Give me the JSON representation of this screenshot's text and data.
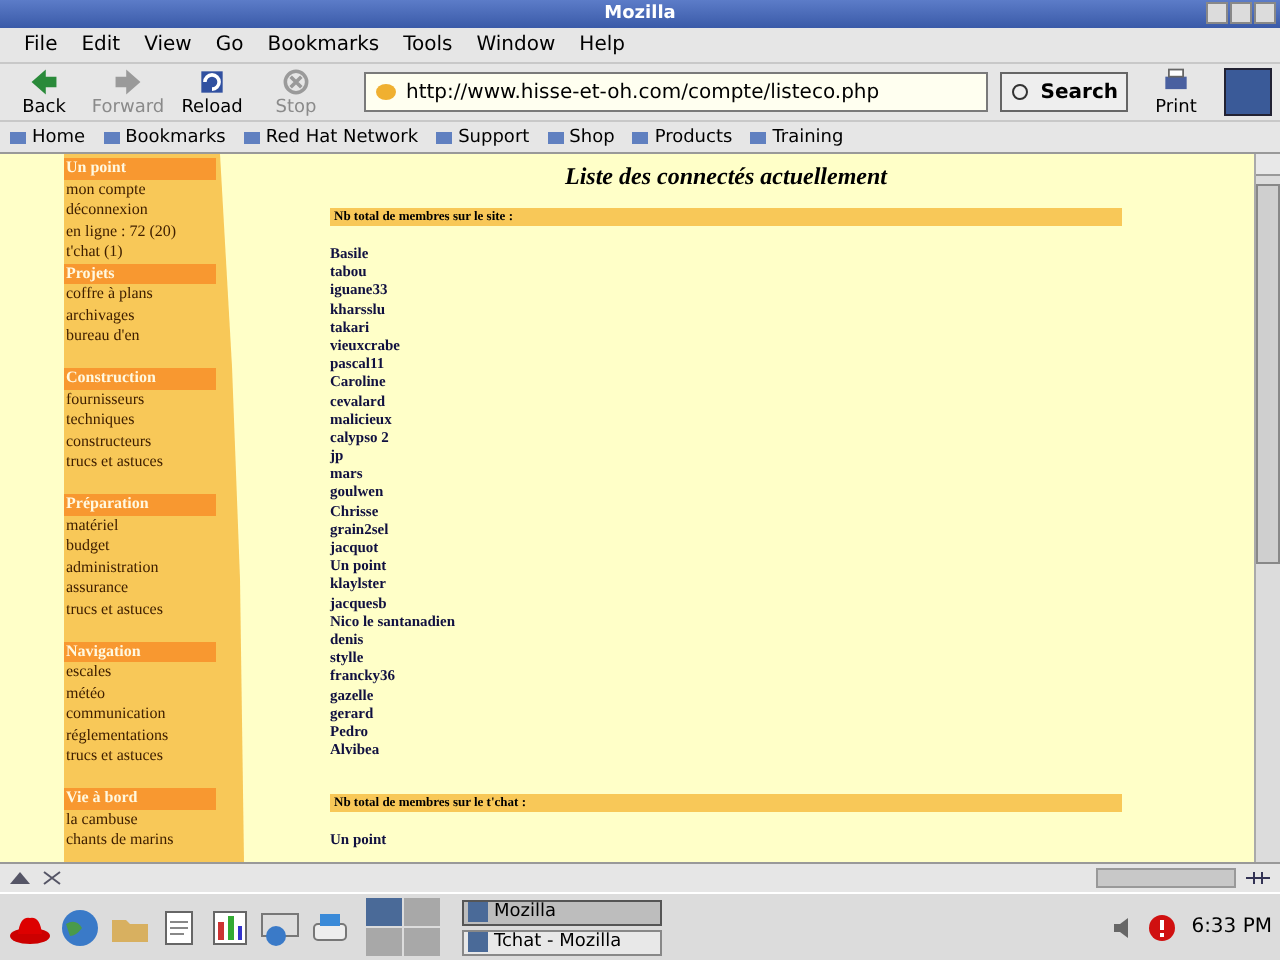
{
  "window": {
    "title": "Mozilla"
  },
  "menu": [
    "File",
    "Edit",
    "View",
    "Go",
    "Bookmarks",
    "Tools",
    "Window",
    "Help"
  ],
  "nav_buttons": [
    {
      "label": "Back",
      "disabled": false,
      "kind": "back"
    },
    {
      "label": "Forward",
      "disabled": true,
      "kind": "forward"
    },
    {
      "label": "Reload",
      "disabled": false,
      "kind": "reload"
    },
    {
      "label": "Stop",
      "disabled": true,
      "kind": "stop"
    }
  ],
  "address": {
    "value": "http://www.hisse-et-oh.com/compte/listeco.php"
  },
  "search_button": "Search",
  "print_button": "Print",
  "personal_toolbar": [
    "Home",
    "Bookmarks",
    "Red Hat Network",
    "Support",
    "Shop",
    "Products",
    "Training"
  ],
  "sidebar": [
    {
      "title": "Un point",
      "items": [
        "mon compte",
        "déconnexion",
        "en ligne : 72 (20)",
        "t'chat (1)"
      ]
    },
    {
      "title": "Projets",
      "items": [
        "coffre à plans",
        "archivages",
        "bureau d'en"
      ]
    },
    {
      "title": "Construction",
      "items": [
        "fournisseurs",
        "techniques",
        "constructeurs",
        "trucs et astuces"
      ]
    },
    {
      "title": "Préparation",
      "items": [
        "matériel",
        "budget",
        "administration",
        "assurance",
        "trucs et astuces"
      ]
    },
    {
      "title": "Navigation",
      "items": [
        "escales",
        "météo",
        "communication",
        "réglementations",
        "trucs et astuces"
      ]
    },
    {
      "title": "Vie à bord",
      "items": [
        "la cambuse",
        "chants de marins"
      ]
    }
  ],
  "page": {
    "title": "Liste des connectés actuellement",
    "sections": [
      {
        "heading": "Nb total de membres sur le site :",
        "members": [
          "Basile",
          "tabou",
          "iguane33",
          "kharsslu",
          "takari",
          "vieuxcrabe",
          "pascal11",
          "Caroline",
          "cevalard",
          "malicieux",
          "calypso 2",
          "jp",
          "mars",
          "goulwen",
          "Chrisse",
          "grain2sel",
          "jacquot",
          "Un point",
          "klaylster",
          "jacquesb",
          "Nico le santanadien",
          "denis",
          "stylle",
          "francky36",
          "gazelle",
          "gerard",
          "Pedro",
          "Alvibea"
        ]
      },
      {
        "heading": "Nb total de membres sur le t'chat :",
        "members": [
          "Un point"
        ]
      }
    ]
  },
  "status_bar": {
    "progress": {
      "level": 0
    }
  },
  "taskbar": {
    "tasks": [
      {
        "label": "Mozilla",
        "selected": true
      },
      {
        "label": "Tchat - Mozilla",
        "selected": false
      }
    ],
    "clock": "6:33 PM"
  }
}
